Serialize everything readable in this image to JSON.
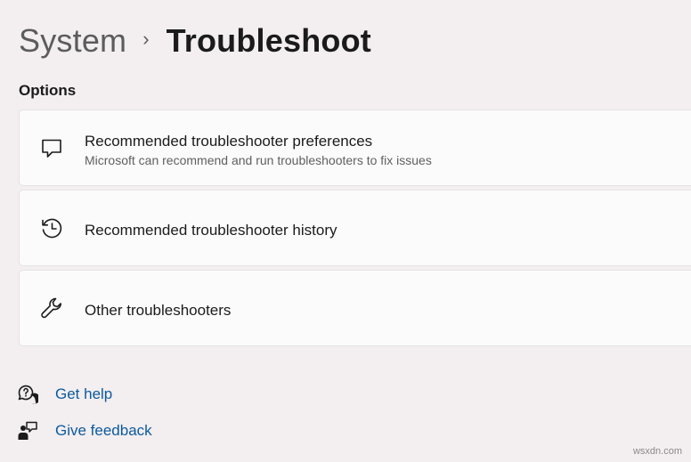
{
  "breadcrumb": {
    "parent": "System",
    "separator": "›",
    "current": "Troubleshoot"
  },
  "section": {
    "title": "Options"
  },
  "options": [
    {
      "icon": "chat-bubble-icon",
      "title": "Recommended troubleshooter preferences",
      "subtitle": "Microsoft can recommend and run troubleshooters to fix issues"
    },
    {
      "icon": "history-icon",
      "title": "Recommended troubleshooter history"
    },
    {
      "icon": "wrench-icon",
      "title": "Other troubleshooters"
    }
  ],
  "links": {
    "help": {
      "icon": "help-chat-icon",
      "label": "Get help"
    },
    "feedback": {
      "icon": "feedback-icon",
      "label": "Give feedback"
    }
  },
  "watermark": "wsxdn.com",
  "colors": {
    "background": "#f3eeef",
    "card": "#fbfbfb",
    "link": "#0b5a9e"
  }
}
